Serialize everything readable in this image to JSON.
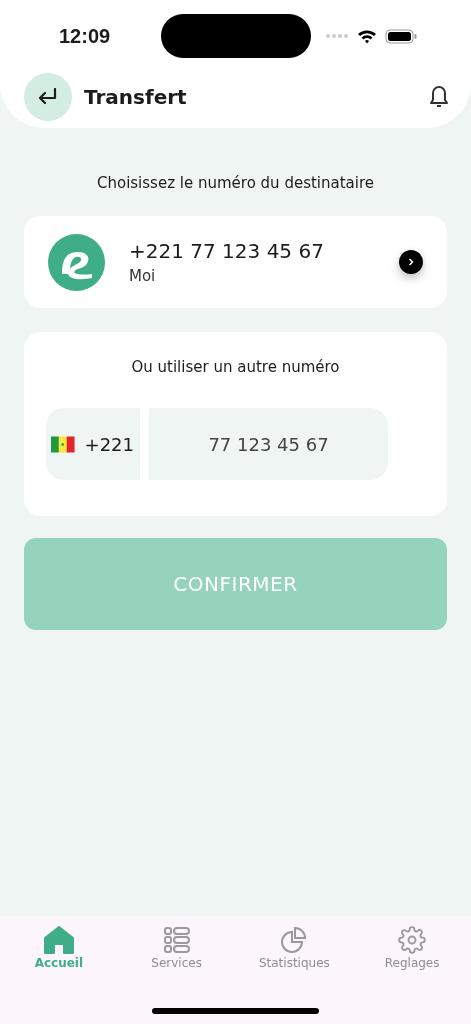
{
  "status_bar": {
    "time": "12:09"
  },
  "header": {
    "title": "Transfert"
  },
  "prompt": "Choisissez le numéro du destinataire",
  "own_number": {
    "number": "+221 77 123 45 67",
    "label": "Moi"
  },
  "other_number": {
    "title": "Ou utiliser un autre numéro",
    "country_code": "+221",
    "value": "77 123 45 67"
  },
  "confirm_button": {
    "label": "CONFIRMER",
    "disabled": true
  },
  "tabs": [
    {
      "kind": "home",
      "label": "Accueil",
      "selected": true
    },
    {
      "kind": "services",
      "label": "Services",
      "selected": false
    },
    {
      "kind": "stats",
      "label": "Statistiques",
      "selected": false
    },
    {
      "kind": "settings",
      "label": "Reglages",
      "selected": false
    }
  ]
}
